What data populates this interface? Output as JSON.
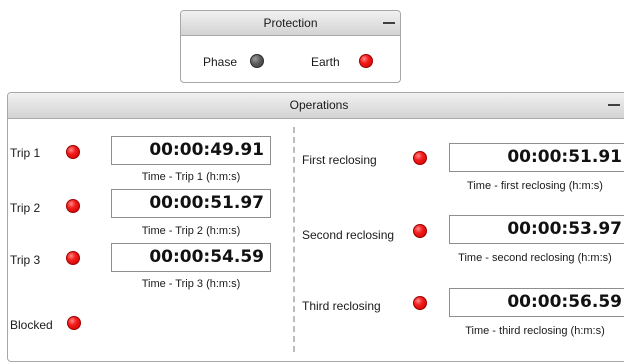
{
  "colors": {
    "led_on": "#ee1111",
    "led_off": "#555555",
    "header": "#d8d8d8"
  },
  "protection": {
    "title": "Protection",
    "phase_label": "Phase",
    "phase_led": "off",
    "earth_label": "Earth",
    "earth_led": "on"
  },
  "operations": {
    "title": "Operations",
    "trip1": {
      "label": "Trip 1",
      "value": "00:00:49.91",
      "caption": "Time - Trip 1 (h:m:s)"
    },
    "trip2": {
      "label": "Trip 2",
      "value": "00:00:51.97",
      "caption": "Time - Trip 2 (h:m:s)"
    },
    "trip3": {
      "label": "Trip 3",
      "value": "00:00:54.59",
      "caption": "Time - Trip 3 (h:m:s)"
    },
    "blocked": {
      "label": "Blocked"
    },
    "first": {
      "label": "First reclosing",
      "value": "00:00:51.91",
      "caption": "Time - first reclosing (h:m:s)"
    },
    "second": {
      "label": "Second reclosing",
      "value": "00:00:53.97",
      "caption": "Time - second reclosing (h:m:s)"
    },
    "third": {
      "label": "Third reclosing",
      "value": "00:00:56.59",
      "caption": "Time - third reclosing (h:m:s)"
    }
  }
}
